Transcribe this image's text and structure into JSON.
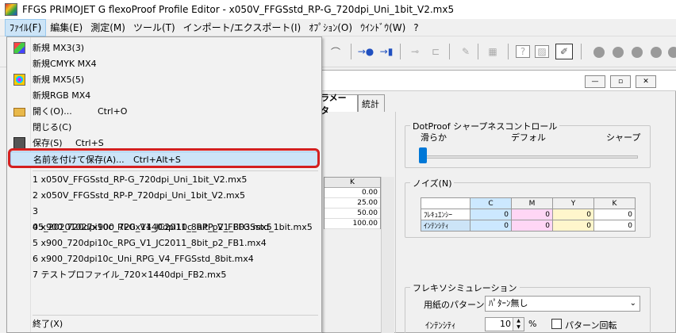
{
  "window": {
    "title": "FFGS PRIMOJET G flexoProof Profile Editor - x050V_FFGSstd_RP-G_720dpi_Uni_1bit_V2.mx5"
  },
  "menubar": [
    {
      "label": "ﾌｧｲﾙ(F)"
    },
    {
      "label": "編集(E)"
    },
    {
      "label": "測定(M)"
    },
    {
      "label": "ツール(T)"
    },
    {
      "label": "インポート/エクスポート(I)"
    },
    {
      "label": "ｵﾌﾟｼｮﾝ(O)"
    },
    {
      "label": "ｳｲﾝﾄﾞｳ(W)"
    },
    {
      "label": "?"
    }
  ],
  "file_menu": {
    "items": [
      {
        "label": "新規 MX3(3)",
        "icon": "new-mx3-icon"
      },
      {
        "label": "新規CMYK MX4",
        "icon": ""
      },
      {
        "label": "新規 MX5(5)",
        "icon": "new-mx5-icon"
      },
      {
        "label": "新規RGB MX4",
        "icon": ""
      },
      {
        "label": "開く(O)...",
        "shortcut": "Ctrl+O",
        "icon": "open-folder-icon"
      },
      {
        "label": "閉じる(C)",
        "icon": ""
      },
      {
        "label": "保存(S)",
        "shortcut": "Ctrl+S",
        "icon": "save-disk-icon"
      },
      {
        "label": "名前を付けて保存(A)...",
        "shortcut": "Ctrl+Alt+S",
        "icon": ""
      }
    ],
    "recent": [
      "1 x050V_FFGSstd_RP-G_720dpi_Uni_1bit_V2.mx5",
      "2 x050V_FFGSstd_RP-P_720dpi_Uni_1bit_V2.mx5",
      "3 05_20201027x900_720x1440dpi10c_RPP_V1_FFGSstd_1bit.mx5",
      "4 x900_720dpi10c_RPG_V1_JC2011_8bit_p2_FB03.mx5",
      "5 x900_720dpi10c_RPG_V1_JC2011_8bit_p2_FB1.mx4",
      "6 x900_720dpi10c_Uni_RPG_V4_FFGSstd_8bit.mx4",
      "7 テストプロファイル_720×1440dpi_FB2.mx5"
    ],
    "exit": "終了(X)"
  },
  "tabs": [
    "ラメータ",
    "統計"
  ],
  "k_table": {
    "header": "K",
    "values": [
      "0.00",
      "25.00",
      "50.00",
      "100.00"
    ]
  },
  "sharpness": {
    "title": "DotProof シャープネスコントロール",
    "left": "滑らか",
    "center": "デフォル",
    "right": "シャープ",
    "value_fraction": 0.0
  },
  "noise": {
    "title": "ノイズ(N)",
    "columns": [
      "C",
      "M",
      "Y",
      "K"
    ],
    "rows": [
      {
        "label": "ﾌﾚｷｭｴﾝｼｰ",
        "values": [
          "0",
          "0",
          "0",
          "0"
        ]
      },
      {
        "label": "ｲﾝﾃﾝｼﾃｨ",
        "values": [
          "0",
          "0",
          "0",
          "0"
        ]
      }
    ]
  },
  "flexo": {
    "title": "フレキソシミュレーション",
    "paper_label": "用紙のパターン",
    "paper_value": "ﾊﾟﾀｰﾝ無し",
    "intensity_label": "ｲﾝﾃﾝｼﾃｨ",
    "intensity_value": "10",
    "percent": "%",
    "rotate_label": "パターン回転"
  },
  "colors": {
    "accent": "#0078d7",
    "highlight_border": "#d42020",
    "hover": "#cce4f7",
    "c_cell": "#cce8ff",
    "m_cell": "#ffd6f5",
    "y_cell": "#fff6cc"
  }
}
